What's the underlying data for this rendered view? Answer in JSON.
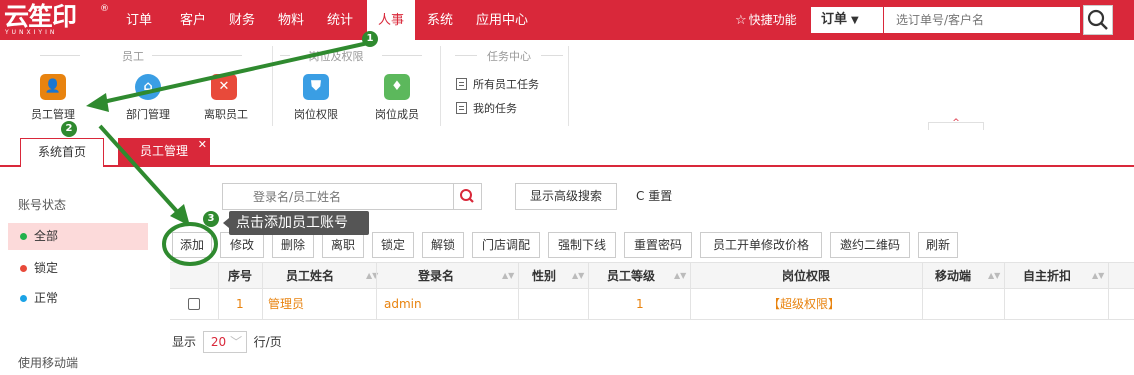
{
  "brand": {
    "name": "云笙印",
    "reg": "®",
    "sub": "YUNXIYIN"
  },
  "nav": {
    "items": [
      "订单",
      "客户",
      "财务",
      "物料",
      "统计",
      "人事",
      "系统",
      "应用中心"
    ],
    "active": "人事"
  },
  "header": {
    "favorites": "快捷功能",
    "search_type": "订单",
    "search_placeholder": "选订单号/客户名"
  },
  "ribbon": {
    "groups": [
      {
        "title": "员工",
        "items": [
          "员工管理",
          "部门管理",
          "离职员工"
        ]
      },
      {
        "title": "岗位及权限",
        "items": [
          "岗位权限",
          "岗位成员"
        ]
      },
      {
        "title": "任务中心",
        "items": [
          "所有员工任务",
          "我的任务"
        ]
      }
    ],
    "colors": {
      "staff": "#e8830f",
      "dept": "#3a9ee4",
      "leave": "#e84a3a",
      "post": "#3a9ee4",
      "member": "#5cb85c"
    }
  },
  "tabs": {
    "home": "系统首页",
    "current": "员工管理",
    "close": "✕"
  },
  "sidebar": {
    "title": "账号状态",
    "items": [
      {
        "label": "全部",
        "color": "#22b14c"
      },
      {
        "label": "锁定",
        "color": "#e84a3a"
      },
      {
        "label": "正常",
        "color": "#1ba3e6"
      }
    ],
    "mobile_title": "使用移动端"
  },
  "toolbar": {
    "search_placeholder": "登录名/员工姓名",
    "advanced": "显示高级搜索",
    "reset": "C 重置",
    "buttons": [
      "添加",
      "修改",
      "删除",
      "离职",
      "锁定",
      "解锁",
      "门店调配",
      "强制下线",
      "重置密码",
      "员工开单修改价格",
      "邀约二维码",
      "刷新"
    ]
  },
  "tooltip": "点击添加员工账号",
  "table": {
    "columns": [
      "序号",
      "员工姓名",
      "登录名",
      "性别",
      "员工等级",
      "岗位权限",
      "移动端",
      "自主折扣"
    ],
    "rows": [
      {
        "no": "1",
        "name": "管理员",
        "login": "admin",
        "gender": "",
        "level": "1",
        "role": "【超级权限】",
        "mobile": "",
        "discount": ""
      }
    ]
  },
  "pager": {
    "prefix": "显示",
    "size": "20",
    "suffix": "行/页"
  },
  "annotations": [
    "1",
    "2",
    "3"
  ],
  "accent": "#d9283a",
  "annotation_color": "#2f8a2f"
}
